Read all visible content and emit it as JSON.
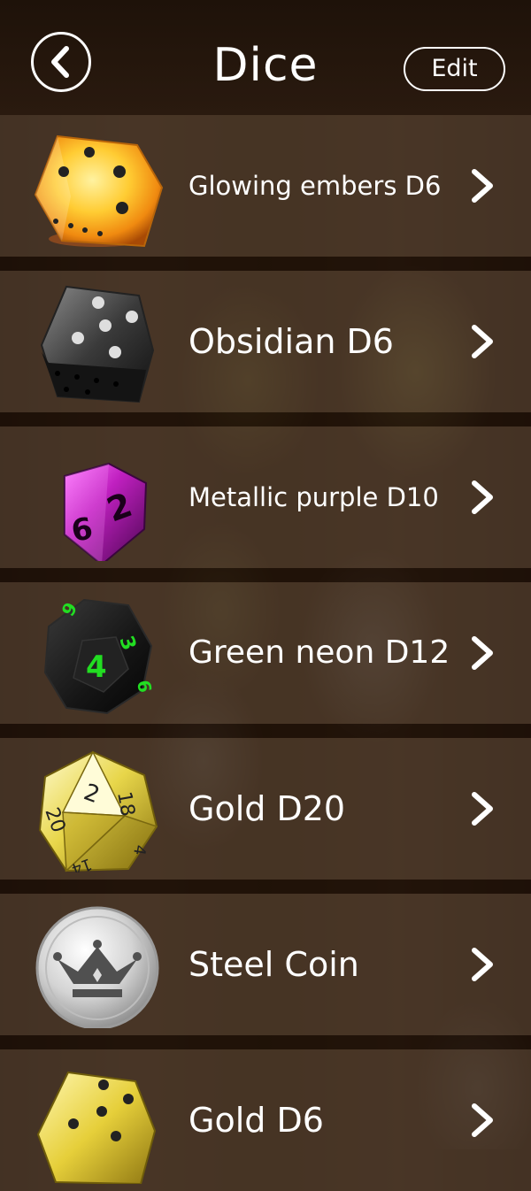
{
  "header": {
    "title": "Dice",
    "edit_label": "Edit"
  },
  "items": [
    {
      "label": "Glowing embers D6"
    },
    {
      "label": "Obsidian D6"
    },
    {
      "label": "Metallic purple D10"
    },
    {
      "label": "Green neon D12"
    },
    {
      "label": "Gold D20"
    },
    {
      "label": "Steel Coin"
    },
    {
      "label": "Gold D6"
    }
  ],
  "icons": {
    "back": "chevron-left-icon",
    "row_arrow": "chevron-right-icon"
  },
  "colors": {
    "text": "#ffffff",
    "header_bg": "#1e1209",
    "row_bg": "#4e3c2d",
    "neon_green": "#22dd22",
    "purple": "#a020a0",
    "gold": "#e8d64a"
  }
}
